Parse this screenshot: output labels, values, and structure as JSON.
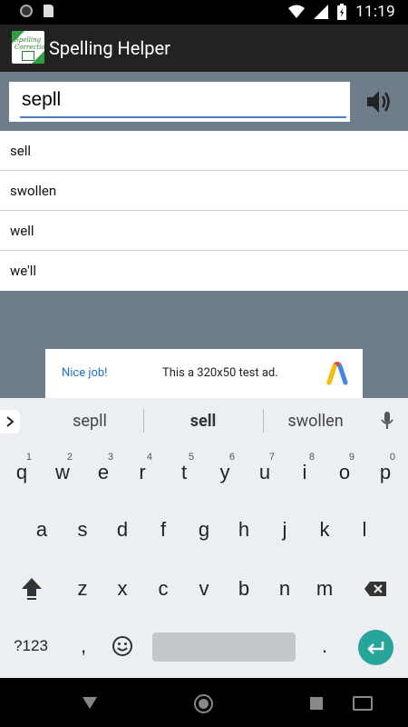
{
  "status_bar": {
    "time": "11:19"
  },
  "app_bar": {
    "title": "Spelling Helper",
    "icon_label": "Spelling Correction"
  },
  "search": {
    "value": "sepll",
    "speaker_icon": "speaker-icon"
  },
  "suggestions_list": [
    "sell",
    "swollen",
    "well",
    "we'll"
  ],
  "ad": {
    "nice_label": "Nice job!",
    "text": "This a 320x50 test ad."
  },
  "keyboard": {
    "suggestions": [
      "sepll",
      "sell",
      "swollen"
    ],
    "row1": [
      {
        "k": "q",
        "h": "1"
      },
      {
        "k": "w",
        "h": "2"
      },
      {
        "k": "e",
        "h": "3"
      },
      {
        "k": "r",
        "h": "4"
      },
      {
        "k": "t",
        "h": "5"
      },
      {
        "k": "y",
        "h": "6"
      },
      {
        "k": "u",
        "h": "7"
      },
      {
        "k": "i",
        "h": "8"
      },
      {
        "k": "o",
        "h": "9"
      },
      {
        "k": "p",
        "h": "0"
      }
    ],
    "row2": [
      "a",
      "s",
      "d",
      "f",
      "g",
      "h",
      "j",
      "k",
      "l"
    ],
    "row3": [
      "z",
      "x",
      "c",
      "v",
      "b",
      "n",
      "m"
    ],
    "symbols_label": "?123",
    "comma": ",",
    "period": "."
  },
  "colors": {
    "accent": "#4a7fc1",
    "app_bar": "#222222",
    "background": "#6f7c89",
    "enter_key": "#26a69a",
    "ad_link": "#1a73e8"
  }
}
